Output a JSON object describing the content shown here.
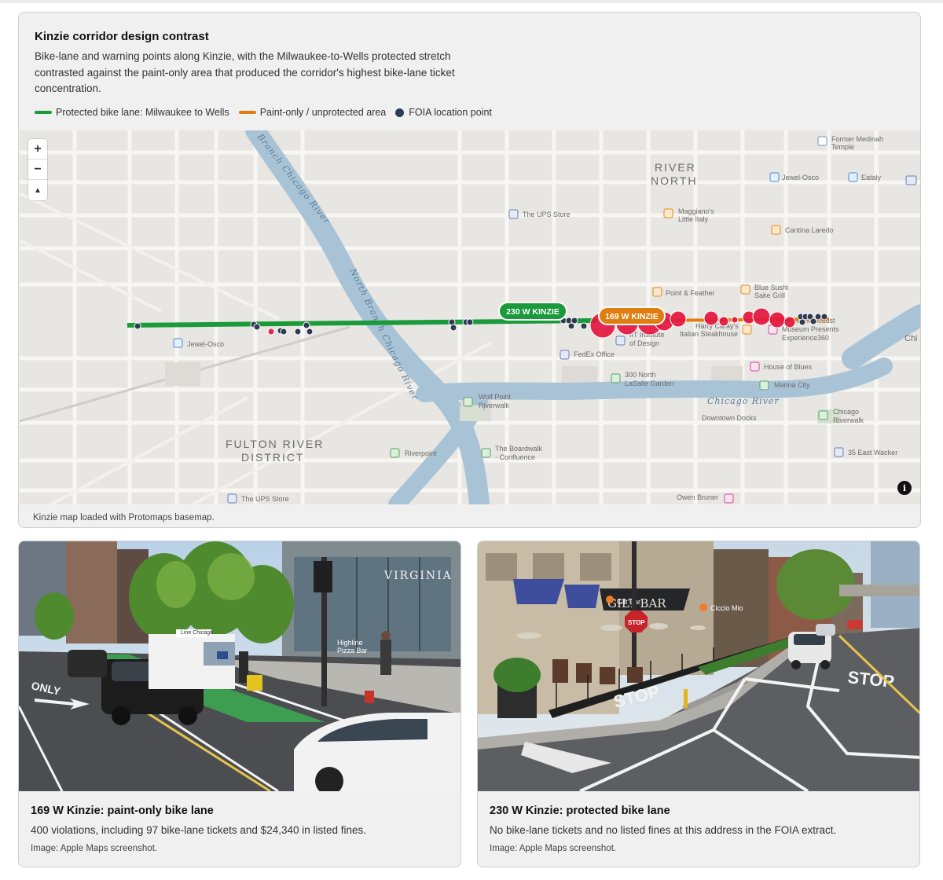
{
  "map_card": {
    "title": "Kinzie corridor design contrast",
    "description": "Bike-lane and warning points along Kinzie, with the Milwaukee-to-Wells protected stretch contrasted against the paint-only area that produced the corridor's highest bike-lane ticket concentration.",
    "legend": [
      {
        "label": "Protected bike lane: Milwaukee to Wells",
        "color": "#1a9a3a",
        "kind": "line"
      },
      {
        "label": "Paint-only / unprotected area",
        "color": "#e07d10",
        "kind": "line"
      },
      {
        "label": "FOIA location point",
        "color": "#2f3b52",
        "kind": "dot"
      }
    ],
    "status": "Kinzie map loaded with Protomaps basemap.",
    "zoom_in": "+",
    "zoom_out": "−",
    "compass": "▲",
    "info": "i"
  },
  "map": {
    "pin_protected": "230 W KINZIE",
    "pin_paint": "169 W KINZIE",
    "districts": [
      "RIVER",
      "NORTH",
      "FULTON RIVER",
      "DISTRICT"
    ],
    "rivers": [
      "North Branch Chicago River",
      "Chicago River",
      "Branch Chicago River"
    ],
    "pois": [
      "Former Medinah",
      "Temple",
      "Jewel-Osco",
      "Eataly",
      "The UPS Store",
      "Maggiano's",
      "Little Italy",
      "Cantina Laredo",
      "Point & Feather",
      "Blue Sushi",
      "Sake Grill",
      "Harry Caray's",
      "Italian Steakhouse",
      "Illinois Holocaust",
      "Museum Presents",
      "Experience360",
      "IIT Institute",
      "of Design",
      "FedEx Office",
      "300 North",
      "LaSalle Garden",
      "House of Blues",
      "Marina City",
      "Wolf Point",
      "Riverwalk",
      "Downtown Docks",
      "Chicago",
      "Riverwalk",
      "Riverpoint",
      "The Boardwalk",
      "- Confluence",
      "35 East Wacker",
      "Jewel-Osco",
      "The UPS Store",
      "Owen Bruner",
      "Chi"
    ],
    "colors": {
      "protected": "#1a9a3a",
      "paint": "#e07d10",
      "point": "#2f3b52",
      "ticket": "#e3163f",
      "water": "#a9c3d6"
    }
  },
  "photos": [
    {
      "title": "169 W Kinzie: paint-only bike lane",
      "description": "400 violations, including 97 bike-lane tickets and $24,340 in listed fines.",
      "credit": "Image: Apple Maps screenshot.",
      "signs": [
        "Highline",
        "Pizza Bar",
        "VIRGINIA",
        "ONLY",
        "Line Chicago"
      ]
    },
    {
      "title": "230 W Kinzie: protected bike lane",
      "description": "No bike-lane tickets and no listed fines at this address in the FOIA extract.",
      "credit": "Image: Apple Maps screenshot.",
      "signs": [
        "Gilt Bar",
        "Ciccio Mio",
        "STOP",
        "STOP",
        "STOP",
        "GILT BAR"
      ]
    }
  ]
}
